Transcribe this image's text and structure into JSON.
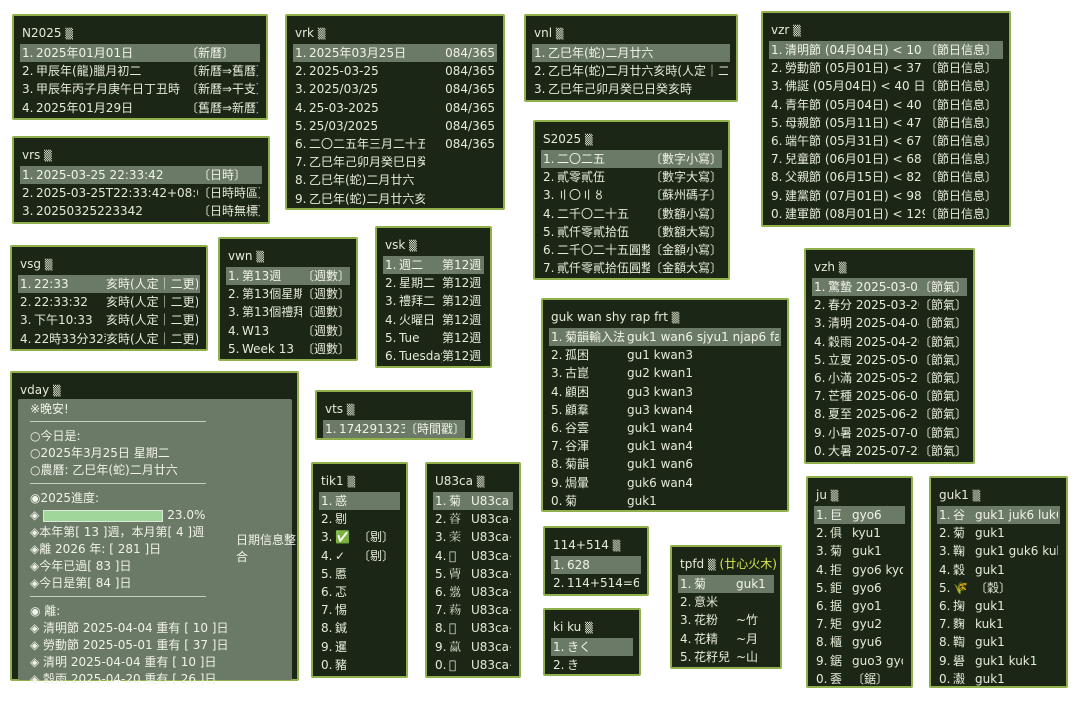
{
  "colors": {
    "panel_bg": "#1b2616",
    "border": "#8fb04a",
    "highlight": "#6b7a66",
    "accent": "#d6e54f"
  },
  "cursor": "▒",
  "panels": {
    "n2025": {
      "title": "N2025",
      "rows": [
        {
          "n": "1.",
          "a": "2025年01月01日",
          "b": "〔新曆〕"
        },
        {
          "n": "2.",
          "a": "甲辰年(龍)臘月初二",
          "b": "〔新曆⇒舊曆〕"
        },
        {
          "n": "3.",
          "a": "甲辰年丙子月庚午日丁丑時",
          "b": "〔新曆⇒干支〕"
        },
        {
          "n": "4.",
          "a": "2025年01月29日",
          "b": "〔舊曆⇒新曆〕"
        }
      ]
    },
    "vrk": {
      "title": "vrk",
      "rows": [
        {
          "n": "1.",
          "a": "2025年03月25日",
          "b": "084/365"
        },
        {
          "n": "2.",
          "a": "2025-03-25",
          "b": "084/365"
        },
        {
          "n": "3.",
          "a": "2025/03/25",
          "b": "084/365"
        },
        {
          "n": "4.",
          "a": "25-03-2025",
          "b": "084/365"
        },
        {
          "n": "5.",
          "a": "25/03/2025",
          "b": "084/365"
        },
        {
          "n": "6.",
          "a": "二〇二五年三月二十五日",
          "b": "084/365"
        },
        {
          "n": "7.",
          "a": "乙巳年己卯月癸巳日癸亥時",
          "b": ""
        },
        {
          "n": "8.",
          "a": "乙巳年(蛇)二月廿六",
          "b": ""
        },
        {
          "n": "9.",
          "a": "乙巳年(蛇)二月廿六亥時(人定｜二更)",
          "b": ""
        }
      ]
    },
    "vnl": {
      "title": "vnl",
      "rows": [
        {
          "n": "1.",
          "a": "乙巳年(蛇)二月廿六"
        },
        {
          "n": "2.",
          "a": "乙巳年(蛇)二月廿六亥時(人定｜二更)"
        },
        {
          "n": "3.",
          "a": "乙巳年己卯月癸巳日癸亥時"
        }
      ]
    },
    "vzr": {
      "title": "vzr",
      "rows": [
        {
          "n": "1.",
          "a": "清明節 (04月04日) < 10 日",
          "b": "〔節日信息〕"
        },
        {
          "n": "2.",
          "a": "勞動節 (05月01日) < 37 日",
          "b": "〔節日信息〕"
        },
        {
          "n": "3.",
          "a": "佛誕 (05月04日) < 40 日",
          "b": "〔節日信息〕"
        },
        {
          "n": "4.",
          "a": "青年節 (05月04日) < 40 日",
          "b": "〔節日信息〕"
        },
        {
          "n": "5.",
          "a": "母親節 (05月11日) < 47 日",
          "b": "〔節日信息〕"
        },
        {
          "n": "6.",
          "a": "端午節 (05月31日) < 67 日",
          "b": "〔節日信息〕"
        },
        {
          "n": "7.",
          "a": "兒童節 (06月01日) < 68 日",
          "b": "〔節日信息〕"
        },
        {
          "n": "8.",
          "a": "父親節 (06月15日) < 82 日",
          "b": "〔節日信息〕"
        },
        {
          "n": "9.",
          "a": "建黨節 (07月01日) < 98 日",
          "b": "〔節日信息〕"
        },
        {
          "n": "0.",
          "a": "建軍節 (08月01日) < 129 日",
          "b": "〔節日信息〕"
        }
      ]
    },
    "vrs": {
      "title": "vrs",
      "rows": [
        {
          "n": "1.",
          "a": "2025-03-25 22:33:42",
          "b": "〔日時〕"
        },
        {
          "n": "2.",
          "a": "2025-03-25T22:33:42+08:00",
          "b": "〔日時時區〕"
        },
        {
          "n": "3.",
          "a": "20250325223342",
          "b": "〔日時無標〕"
        }
      ]
    },
    "s2025": {
      "title": "S2025",
      "rows": [
        {
          "n": "1.",
          "a": "二〇二五",
          "b": "〔數字小寫〕"
        },
        {
          "n": "2.",
          "a": "貳零貳伍",
          "b": "〔數字大寫〕"
        },
        {
          "n": "3.",
          "a": "〢〇〢〥",
          "b": "〔蘇州碼子〕"
        },
        {
          "n": "4.",
          "a": "二千〇二十五",
          "b": "〔數額小寫〕"
        },
        {
          "n": "5.",
          "a": "貳仟零貳拾伍",
          "b": "〔數額大寫〕"
        },
        {
          "n": "6.",
          "a": "二千〇二十五圓整",
          "b": "〔金額小寫〕"
        },
        {
          "n": "7.",
          "a": "貳仟零貳拾伍圓整",
          "b": "〔金額大寫〕"
        }
      ]
    },
    "vsg": {
      "title": "vsg",
      "rows": [
        {
          "n": "1.",
          "a": "22:33",
          "b": "亥時(人定｜二更)"
        },
        {
          "n": "2.",
          "a": "22:33:32",
          "b": "亥時(人定｜二更)"
        },
        {
          "n": "3.",
          "a": "下午10:33",
          "b": "亥時(人定｜二更)"
        },
        {
          "n": "4.",
          "a": "22時33分32秒",
          "b": "亥時(人定｜二更)"
        }
      ]
    },
    "vwn": {
      "title": "vwn",
      "rows": [
        {
          "n": "1.",
          "a": "第13週",
          "b": "〔週數〕"
        },
        {
          "n": "2.",
          "a": "第13個星期",
          "b": "〔週數〕"
        },
        {
          "n": "3.",
          "a": "第13個禮拜",
          "b": "〔週數〕"
        },
        {
          "n": "4.",
          "a": "W13",
          "b": "〔週數〕"
        },
        {
          "n": "5.",
          "a": "Week 13",
          "b": "〔週數〕"
        }
      ]
    },
    "vsk": {
      "title": "vsk",
      "rows": [
        {
          "n": "1.",
          "a": "週二",
          "b": "第12週"
        },
        {
          "n": "2.",
          "a": "星期二",
          "b": "第12週"
        },
        {
          "n": "3.",
          "a": "禮拜二",
          "b": "第12週"
        },
        {
          "n": "4.",
          "a": "火曜日",
          "b": "第12週"
        },
        {
          "n": "5.",
          "a": "Tue",
          "b": "第12週"
        },
        {
          "n": "6.",
          "a": "Tuesday",
          "b": "第12週"
        }
      ]
    },
    "vzh": {
      "title": "vzh",
      "rows": [
        {
          "n": "1.",
          "a": "驚蟄 2025-03-05",
          "b": "〔節氣〕"
        },
        {
          "n": "2.",
          "a": "春分 2025-03-20",
          "b": "〔節氣〕"
        },
        {
          "n": "3.",
          "a": "清明 2025-04-04",
          "b": "〔節氣〕"
        },
        {
          "n": "4.",
          "a": "穀雨 2025-04-20",
          "b": "〔節氣〕"
        },
        {
          "n": "5.",
          "a": "立夏 2025-05-05",
          "b": "〔節氣〕"
        },
        {
          "n": "6.",
          "a": "小滿 2025-05-21",
          "b": "〔節氣〕"
        },
        {
          "n": "7.",
          "a": "芒種 2025-06-05",
          "b": "〔節氣〕"
        },
        {
          "n": "8.",
          "a": "夏至 2025-06-21",
          "b": "〔節氣〕"
        },
        {
          "n": "9.",
          "a": "小暑 2025-07-07",
          "b": "〔節氣〕"
        },
        {
          "n": "0.",
          "a": "大暑 2025-07-22",
          "b": "〔節氣〕"
        }
      ]
    },
    "guk": {
      "title": "guk wan shy rap frt",
      "rows": [
        {
          "n": "1.",
          "a": "菊韻輸入法",
          "b": "guk1 wan6 sjyu1 njap6 faat3"
        },
        {
          "n": "2.",
          "a": "孤困",
          "b": "gu1 kwan3"
        },
        {
          "n": "3.",
          "a": "古崑",
          "b": "gu2 kwan1"
        },
        {
          "n": "4.",
          "a": "顧困",
          "b": "gu3 kwan3"
        },
        {
          "n": "5.",
          "a": "顧羣",
          "b": "gu3 kwan4"
        },
        {
          "n": "6.",
          "a": "谷雲",
          "b": "guk1 wan4"
        },
        {
          "n": "7.",
          "a": "谷渾",
          "b": "guk1 wan4"
        },
        {
          "n": "8.",
          "a": "菊韻",
          "b": "guk1 wan6"
        },
        {
          "n": "9.",
          "a": "焗暈",
          "b": "guk6 wan4"
        },
        {
          "n": "0.",
          "a": "菊",
          "b": "guk1"
        }
      ]
    },
    "vday": {
      "title": "vday",
      "index": "1.",
      "tag": "日期信息整合",
      "greeting": "※晚安!",
      "today_label": "○今日是:",
      "today_date": "○2025年3月25日 星期二",
      "lunar": "○農曆: 乙巳年(蛇)二月廿六",
      "progress_label": "◉2025進度:",
      "progress_pct": "23.0%",
      "progress_value": 0.23,
      "week": "◈本年第[ 13 ]週，本月第[ 4 ]週",
      "left": "◈離 2026 年: [ 281 ]日",
      "passed": "◈今年已過[ 83 ]日",
      "dayn": "◈今日是第[ 84 ]日",
      "away_label": "◉ 離:",
      "away": [
        "◈ 清明節 2025-04-04 重有 [ 10 ]日",
        "◈ 勞動節 2025-05-01 重有 [ 37 ]日",
        "◈ 清明 2025-04-04 重有 [ 10 ]日",
        "◈ 穀雨 2025-04-20 重有 [ 26 ]日"
      ]
    },
    "vts": {
      "title": "vts",
      "rows": [
        {
          "n": "1.",
          "a": "1742913230",
          "b": "〔時間戳〕"
        }
      ]
    },
    "tik1": {
      "title": "tik1",
      "rows": [
        {
          "n": "1.",
          "a": "惑",
          "b": ""
        },
        {
          "n": "2.",
          "a": "剔",
          "b": ""
        },
        {
          "n": "3.",
          "a": "✅",
          "b": "〔剔〕"
        },
        {
          "n": "4.",
          "a": "✓",
          "b": "〔剔〕"
        },
        {
          "n": "5.",
          "a": "慝",
          "b": ""
        },
        {
          "n": "6.",
          "a": "忑",
          "b": ""
        },
        {
          "n": "7.",
          "a": "惕",
          "b": ""
        },
        {
          "n": "8.",
          "a": "鍼",
          "b": ""
        },
        {
          "n": "9.",
          "a": "暹",
          "b": ""
        },
        {
          "n": "0.",
          "a": "豬",
          "b": ""
        }
      ]
    },
    "u83ca": {
      "title": "U83ca",
      "rows": [
        {
          "n": "1.",
          "a": "菊",
          "b": "U83ca"
        },
        {
          "n": "2.",
          "a": "𦴔",
          "b": "U83ca~0"
        },
        {
          "n": "3.",
          "a": "𦴕",
          "b": "U83ca~1"
        },
        {
          "n": "4.",
          "a": "𦴖",
          "b": "U83ca~2"
        },
        {
          "n": "5.",
          "a": "𦴗",
          "b": "U83ca~3"
        },
        {
          "n": "6.",
          "a": "𦴘",
          "b": "U83ca~4"
        },
        {
          "n": "7.",
          "a": "𦴙",
          "b": "U83ca~5"
        },
        {
          "n": "8.",
          "a": "𦴚",
          "b": "U83ca~6"
        },
        {
          "n": "9.",
          "a": "𦴛",
          "b": "U83ca~7"
        },
        {
          "n": "0.",
          "a": "𦴜",
          "b": "U83ca~8"
        }
      ]
    },
    "n114": {
      "title": "114+514",
      "rows": [
        {
          "n": "1.",
          "a": "628",
          "b": ""
        },
        {
          "n": "2.",
          "a": "114+514=628",
          "b": ""
        }
      ]
    },
    "kiku": {
      "title": "ki ku",
      "rows": [
        {
          "n": "1.",
          "a": "きく",
          "b": ""
        },
        {
          "n": "2.",
          "a": "き",
          "b": ""
        }
      ]
    },
    "tpfd": {
      "title": "tpfd",
      "subtitle": "(廿心火木)",
      "rows": [
        {
          "n": "1.",
          "a": "菊",
          "b": "guk1"
        },
        {
          "n": "2.",
          "a": "意米",
          "b": ""
        },
        {
          "n": "3.",
          "a": "花粉",
          "b": "~竹"
        },
        {
          "n": "4.",
          "a": "花精",
          "b": "~月"
        },
        {
          "n": "5.",
          "a": "花籽兒",
          "b": "~山"
        }
      ]
    },
    "ju": {
      "title": "ju",
      "rows": [
        {
          "n": "1.",
          "a": "巨",
          "b": "gyo6"
        },
        {
          "n": "2.",
          "a": "俱",
          "b": "kyu1"
        },
        {
          "n": "3.",
          "a": "菊",
          "b": "guk1"
        },
        {
          "n": "4.",
          "a": "拒",
          "b": "gyo6 kyo5"
        },
        {
          "n": "5.",
          "a": "鉅",
          "b": "gyo6"
        },
        {
          "n": "6.",
          "a": "据",
          "b": "gyo1"
        },
        {
          "n": "7.",
          "a": "矩",
          "b": "gyu2"
        },
        {
          "n": "8.",
          "a": "櫃",
          "b": "gyu6"
        },
        {
          "n": "9.",
          "a": "鋸",
          "b": "guo3 gyo3"
        },
        {
          "n": "0.",
          "a": "𠀾",
          "b": "〔鋸〕"
        }
      ]
    },
    "guk1": {
      "title": "guk1",
      "rows": [
        {
          "n": "1.",
          "a": "谷",
          "b": "guk1 juk6 luk6"
        },
        {
          "n": "2.",
          "a": "菊",
          "b": "guk1"
        },
        {
          "n": "3.",
          "a": "鞠",
          "b": "guk1 guk6 kuk1"
        },
        {
          "n": "4.",
          "a": "穀",
          "b": "guk1"
        },
        {
          "n": "5.",
          "a": "🌾",
          "b": "〔穀〕"
        },
        {
          "n": "6.",
          "a": "掬",
          "b": "guk1"
        },
        {
          "n": "7.",
          "a": "麴",
          "b": "kuk1"
        },
        {
          "n": "8.",
          "a": "鞫",
          "b": "guk1"
        },
        {
          "n": "9.",
          "a": "礐",
          "b": "guk1 kuk1"
        },
        {
          "n": "0.",
          "a": "瀫",
          "b": "guk1"
        }
      ]
    }
  }
}
